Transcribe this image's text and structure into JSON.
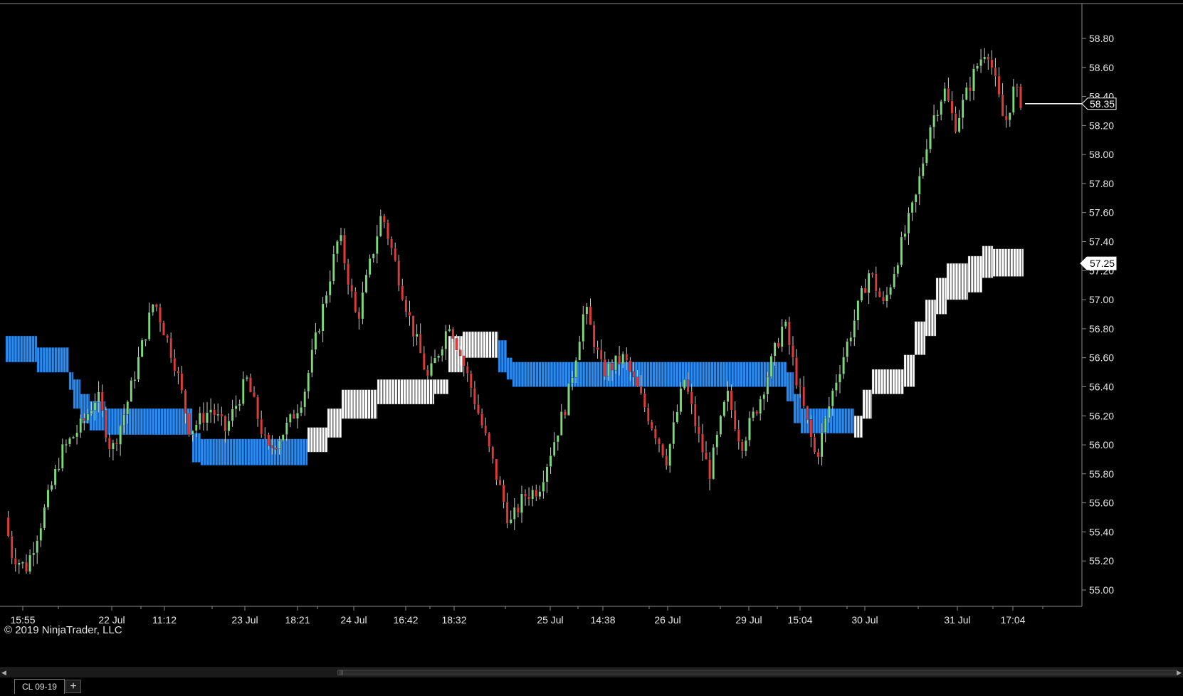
{
  "copyright": "© 2019 NinjaTrader, LLC",
  "tabs": [
    {
      "label": "CL 09-19",
      "active": true
    }
  ],
  "add_tab_label": "+",
  "chart_data": {
    "type": "candlestick",
    "instrument": "CL 09-19",
    "ylim": [
      54.95,
      58.95
    ],
    "y_ticks": [
      "58.80",
      "58.60",
      "58.40",
      "58.20",
      "58.00",
      "57.80",
      "57.60",
      "57.40",
      "57.20",
      "57.00",
      "56.80",
      "56.60",
      "56.40",
      "56.20",
      "56.00",
      "55.80",
      "55.60",
      "55.40",
      "55.20",
      "55.00"
    ],
    "x_labels": [
      "15:55",
      "22 Jul",
      "11:12",
      "23 Jul",
      "18:21",
      "24 Jul",
      "16:42",
      "18:32",
      "25 Jul",
      "14:38",
      "26 Jul",
      "29 Jul",
      "15:04",
      "30 Jul",
      "31 Jul",
      "17:04"
    ],
    "price_markers": [
      {
        "value": 58.35,
        "label": "58.35",
        "style": "last-price"
      },
      {
        "value": 57.25,
        "label": "57.25",
        "style": "band-level"
      }
    ],
    "colors": {
      "up": "#7ed97e",
      "down": "#e23a3a",
      "wick": "#cccccc",
      "band_blue": "#2a8cf0",
      "band_white": "#ffffff",
      "grid_text": "#e6e6e6"
    },
    "path": [
      [
        0,
        55.75
      ],
      [
        20,
        55.25
      ],
      [
        40,
        55.15
      ],
      [
        60,
        55.45
      ],
      [
        90,
        55.95
      ],
      [
        120,
        56.15
      ],
      [
        140,
        56.35
      ],
      [
        160,
        55.95
      ],
      [
        180,
        56.25
      ],
      [
        220,
        57.0
      ],
      [
        250,
        56.55
      ],
      [
        270,
        56.1
      ],
      [
        300,
        56.25
      ],
      [
        320,
        56.1
      ],
      [
        350,
        56.45
      ],
      [
        380,
        55.95
      ],
      [
        410,
        56.15
      ],
      [
        430,
        56.35
      ],
      [
        480,
        57.45
      ],
      [
        505,
        56.85
      ],
      [
        540,
        57.6
      ],
      [
        580,
        56.85
      ],
      [
        605,
        56.45
      ],
      [
        635,
        56.85
      ],
      [
        665,
        56.4
      ],
      [
        700,
        55.8
      ],
      [
        720,
        55.45
      ],
      [
        740,
        55.65
      ],
      [
        760,
        55.7
      ],
      [
        800,
        56.3
      ],
      [
        825,
        56.95
      ],
      [
        850,
        56.5
      ],
      [
        880,
        56.6
      ],
      [
        910,
        56.25
      ],
      [
        940,
        55.9
      ],
      [
        965,
        56.45
      ],
      [
        985,
        56.05
      ],
      [
        1000,
        55.8
      ],
      [
        1025,
        56.35
      ],
      [
        1045,
        56.0
      ],
      [
        1070,
        56.3
      ],
      [
        1105,
        56.85
      ],
      [
        1125,
        56.4
      ],
      [
        1150,
        55.9
      ],
      [
        1175,
        56.4
      ],
      [
        1200,
        56.8
      ],
      [
        1225,
        57.2
      ],
      [
        1245,
        56.95
      ],
      [
        1265,
        57.3
      ],
      [
        1290,
        57.7
      ],
      [
        1310,
        58.2
      ],
      [
        1330,
        58.45
      ],
      [
        1345,
        58.2
      ],
      [
        1375,
        58.6
      ],
      [
        1390,
        58.75
      ],
      [
        1415,
        58.2
      ],
      [
        1428,
        58.45
      ],
      [
        1440,
        58.35
      ]
    ],
    "bands": [
      {
        "color": "blue",
        "segments": [
          [
            8,
            52,
            56.75,
            56.57
          ],
          [
            52,
            97,
            56.67,
            56.5
          ],
          [
            97,
            103,
            56.5,
            56.38
          ],
          [
            103,
            113,
            56.45,
            56.25
          ],
          [
            113,
            126,
            56.35,
            56.15
          ],
          [
            126,
            148,
            56.3,
            56.1
          ],
          [
            148,
            270,
            56.25,
            56.07
          ],
          [
            270,
            282,
            56.08,
            55.88
          ],
          [
            282,
            432,
            56.04,
            55.86
          ],
          [
            700,
            712,
            56.72,
            56.5
          ],
          [
            712,
            720,
            56.6,
            56.45
          ],
          [
            720,
            1105,
            56.57,
            56.4
          ],
          [
            1105,
            1115,
            56.5,
            56.3
          ],
          [
            1115,
            1125,
            56.35,
            56.15
          ],
          [
            1125,
            1200,
            56.25,
            56.08
          ]
        ]
      },
      {
        "color": "white",
        "segments": [
          [
            432,
            460,
            56.12,
            55.95
          ],
          [
            460,
            480,
            56.25,
            56.05
          ],
          [
            480,
            530,
            56.38,
            56.18
          ],
          [
            530,
            610,
            56.45,
            56.28
          ],
          [
            610,
            630,
            56.45,
            56.35
          ],
          [
            630,
            650,
            56.75,
            56.5
          ],
          [
            650,
            700,
            56.78,
            56.6
          ],
          [
            1200,
            1212,
            56.2,
            56.05
          ],
          [
            1212,
            1225,
            56.38,
            56.18
          ],
          [
            1225,
            1270,
            56.52,
            56.35
          ],
          [
            1270,
            1285,
            56.62,
            56.4
          ],
          [
            1285,
            1300,
            56.85,
            56.62
          ],
          [
            1300,
            1315,
            57.0,
            56.75
          ],
          [
            1315,
            1330,
            57.15,
            56.9
          ],
          [
            1330,
            1360,
            57.25,
            57.0
          ],
          [
            1360,
            1380,
            57.3,
            57.05
          ],
          [
            1380,
            1395,
            57.37,
            57.15
          ],
          [
            1395,
            1438,
            57.35,
            57.16
          ]
        ]
      }
    ]
  }
}
